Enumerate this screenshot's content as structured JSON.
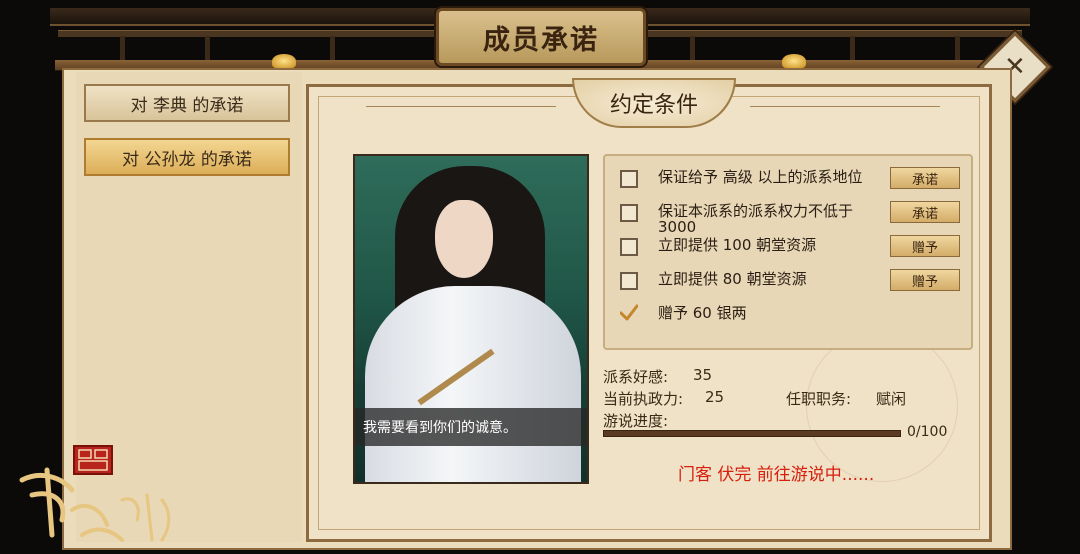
{
  "header": {
    "title": "成员承诺"
  },
  "tabs": [
    {
      "label": "对 李典 的承诺"
    },
    {
      "label": "对 公孙龙 的承诺"
    }
  ],
  "section": {
    "title": "约定条件"
  },
  "portrait": {
    "speech": "我需要看到你们的诚意。"
  },
  "conditions": [
    {
      "text": "保证给予 高级 以上的派系地位",
      "button": "承诺",
      "checked": false
    },
    {
      "text": "保证本派系的派系权力不低于3000",
      "button": "承诺",
      "checked": false
    },
    {
      "text": "立即提供 100 朝堂资源",
      "button": "赠予",
      "checked": false
    },
    {
      "text": "立即提供 80 朝堂资源",
      "button": "赠予",
      "checked": false
    },
    {
      "text": "赠予 60 银两",
      "button": "",
      "checked": true
    }
  ],
  "stats": {
    "favor_label": "派系好感:",
    "favor_value": "35",
    "power_label": "当前执政力:",
    "power_value": "25",
    "duty_label": "任职职务:",
    "duty_value": "赋闲",
    "progress_label": "游说进度:",
    "progress_text": "0/100",
    "progress_fraction": 0
  },
  "status": {
    "message": "门客 伏完 前往游说中......"
  },
  "logo": {
    "text": "豪杰成长计划"
  },
  "colors": {
    "accent": "#d81e0e",
    "parchment": "#efe2c6",
    "frame": "#8e6a40"
  }
}
